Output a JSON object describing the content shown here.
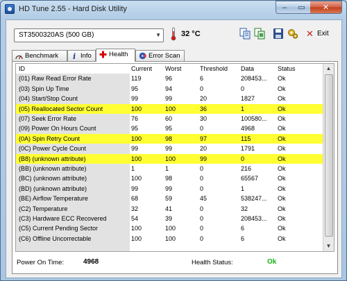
{
  "window": {
    "title": "HD Tune 2.55 - Hard Disk Utility",
    "controls": {
      "minimize": "–",
      "maximize": "▭",
      "close": "✕"
    }
  },
  "toolbar": {
    "drive": "ST3500320AS (500 GB)",
    "temperature": "32 °C",
    "exit_label": "Exit",
    "icons": [
      "copy-text-icon",
      "copy-screenshot-icon",
      "save-icon",
      "options-icon",
      "exit-icon"
    ]
  },
  "tabs": [
    {
      "label": "Benchmark",
      "icon": "benchmark-icon"
    },
    {
      "label": "Info",
      "icon": "info-icon"
    },
    {
      "label": "Health",
      "icon": "health-cross-icon",
      "active": true
    },
    {
      "label": "Error Scan",
      "icon": "error-scan-icon"
    }
  ],
  "table": {
    "columns": [
      "ID",
      "Current",
      "Worst",
      "Threshold",
      "Data",
      "Status"
    ],
    "rows": [
      {
        "id": "(01) Raw Read Error Rate",
        "current": "119",
        "worst": "96",
        "threshold": "6",
        "data": "208453...",
        "status": "Ok",
        "highlight": false
      },
      {
        "id": "(03) Spin Up Time",
        "current": "95",
        "worst": "94",
        "threshold": "0",
        "data": "0",
        "status": "Ok",
        "highlight": false
      },
      {
        "id": "(04) Start/Stop Count",
        "current": "99",
        "worst": "99",
        "threshold": "20",
        "data": "1827",
        "status": "Ok",
        "highlight": false
      },
      {
        "id": "(05) Reallocated Sector Count",
        "current": "100",
        "worst": "100",
        "threshold": "36",
        "data": "1",
        "status": "Ok",
        "highlight": true
      },
      {
        "id": "(07) Seek Error Rate",
        "current": "76",
        "worst": "60",
        "threshold": "30",
        "data": "100580...",
        "status": "Ok",
        "highlight": false
      },
      {
        "id": "(09) Power On Hours Count",
        "current": "95",
        "worst": "95",
        "threshold": "0",
        "data": "4968",
        "status": "Ok",
        "highlight": false
      },
      {
        "id": "(0A) Spin Retry Count",
        "current": "100",
        "worst": "98",
        "threshold": "97",
        "data": "115",
        "status": "Ok",
        "highlight": true
      },
      {
        "id": "(0C) Power Cycle Count",
        "current": "99",
        "worst": "99",
        "threshold": "20",
        "data": "1791",
        "status": "Ok",
        "highlight": false
      },
      {
        "id": "(B8) (unknown attribute)",
        "current": "100",
        "worst": "100",
        "threshold": "99",
        "data": "0",
        "status": "Ok",
        "highlight": true
      },
      {
        "id": "(BB) (unknown attribute)",
        "current": "1",
        "worst": "1",
        "threshold": "0",
        "data": "216",
        "status": "Ok",
        "highlight": false
      },
      {
        "id": "(BC) (unknown attribute)",
        "current": "100",
        "worst": "98",
        "threshold": "0",
        "data": "65567",
        "status": "Ok",
        "highlight": false
      },
      {
        "id": "(BD) (unknown attribute)",
        "current": "99",
        "worst": "99",
        "threshold": "0",
        "data": "1",
        "status": "Ok",
        "highlight": false
      },
      {
        "id": "(BE) Airflow Temperature",
        "current": "68",
        "worst": "59",
        "threshold": "45",
        "data": "538247...",
        "status": "Ok",
        "highlight": false
      },
      {
        "id": "(C2) Temperature",
        "current": "32",
        "worst": "41",
        "threshold": "0",
        "data": "32",
        "status": "Ok",
        "highlight": false
      },
      {
        "id": "(C3) Hardware ECC Recovered",
        "current": "54",
        "worst": "39",
        "threshold": "0",
        "data": "208453...",
        "status": "Ok",
        "highlight": false
      },
      {
        "id": "(C5) Current Pending Sector",
        "current": "100",
        "worst": "100",
        "threshold": "0",
        "data": "6",
        "status": "Ok",
        "highlight": false
      },
      {
        "id": "(C6) Offline Uncorrectable",
        "current": "100",
        "worst": "100",
        "threshold": "0",
        "data": "6",
        "status": "Ok",
        "highlight": false
      }
    ]
  },
  "footer": {
    "power_on_label": "Power On Time:",
    "power_on_value": "4968",
    "health_label": "Health Status:",
    "health_value": "Ok"
  },
  "colors": {
    "highlight": "#ffff33",
    "health_ok": "#16b316"
  }
}
